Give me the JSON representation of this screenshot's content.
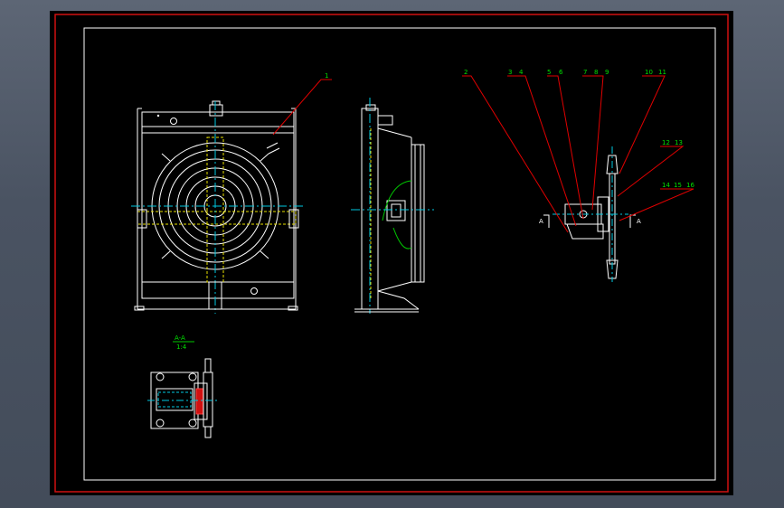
{
  "colors": {
    "background": "#000000",
    "frame_outer": "#d01010",
    "frame_inner": "#ffffff",
    "leader": "#e00000",
    "label": "#00e000",
    "centerline": "#00c8e0",
    "hidden": "#e8e000",
    "section_fill": "#d01010"
  },
  "balloons": {
    "main_view": "1",
    "detail": [
      "2",
      "3",
      "4",
      "5",
      "6",
      "7",
      "8",
      "9",
      "10",
      "11",
      "12",
      "13",
      "14",
      "15",
      "16"
    ]
  },
  "section": {
    "cut_marker": "A",
    "title": "A-A",
    "scale": "1:4"
  }
}
